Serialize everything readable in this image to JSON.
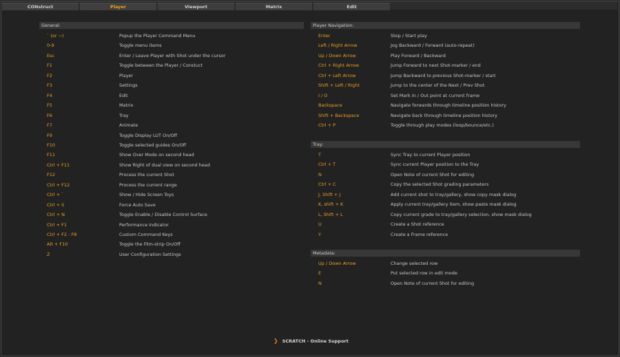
{
  "tabs": [
    {
      "label": "CONstruct",
      "active": false
    },
    {
      "label": "Player",
      "active": true
    },
    {
      "label": "Viewport",
      "active": false
    },
    {
      "label": "Matrix",
      "active": false
    },
    {
      "label": "Edit",
      "active": false
    }
  ],
  "colors": {
    "accent": "#f0a020",
    "text": "#c9c9c9",
    "background": "#222222",
    "section_bg": "#383838"
  },
  "sections": {
    "general": {
      "title": "General:",
      "rows": [
        {
          "key": "` (or ~)",
          "desc": "Popup the Player Command Menu"
        },
        {
          "key": "0-9",
          "desc": "Toggle menu items"
        },
        {
          "key": "Esc",
          "desc": "Enter / Leave Player with Shot under the cursor"
        },
        {
          "key": "F1",
          "desc": "Toggle between the Player / Constuct"
        },
        {
          "key": "F2",
          "desc": "Player"
        },
        {
          "key": "F3",
          "desc": "Settings"
        },
        {
          "key": "F4",
          "desc": "Edit"
        },
        {
          "key": "F5",
          "desc": "Matrix"
        },
        {
          "key": "F6",
          "desc": "Tray"
        },
        {
          "key": "F7",
          "desc": "Animate"
        },
        {
          "key": "F9",
          "desc": "Toggle Display LUT On/Off"
        },
        {
          "key": "F10",
          "desc": "Toggle selected guides On/Off"
        },
        {
          "key": "F11",
          "desc": "Show Over Mode on second head"
        },
        {
          "key": "Ctrl + F11",
          "desc": "Show Right of dual view on second head"
        },
        {
          "key": "F12",
          "desc": "Process the current Shot"
        },
        {
          "key": "Ctrl + F12",
          "desc": "Process the current range"
        },
        {
          "key": "Ctrl + `",
          "desc": "Show / Hide Screen Toys"
        },
        {
          "key": "Ctrl + S",
          "desc": "Force Auto Save"
        },
        {
          "key": "Ctrl + N",
          "desc": "Toggle Enable / Disable Control Surface"
        },
        {
          "key": "Ctrl + F1",
          "desc": "Performance indicator"
        },
        {
          "key": "Ctrl + F2 - F8",
          "desc": "Custom Command Keys"
        },
        {
          "key": "Alt + F10",
          "desc": "Toggle the Film-strip On/Off"
        },
        {
          "key": "Z",
          "desc": "User Configuration Settings"
        }
      ]
    },
    "player_navigation": {
      "title": "Player Navigation:",
      "rows": [
        {
          "key": "Enter",
          "desc": "Stop / Start play"
        },
        {
          "key": "Left / Right Arrow",
          "desc": "Jog Backward / Forward (auto-repeat)"
        },
        {
          "key": "Up / Down Arrow",
          "desc": "Play Forward / Backward"
        },
        {
          "key": "Ctrl + Right Arrow",
          "desc": "Jump Forward to next Shot-marker / end"
        },
        {
          "key": "Ctrl + Left Arrow",
          "desc": "Jump Backward to previous Shot-marker / start"
        },
        {
          "key": "Shift + Left / Right",
          "desc": "Jump to the center of the Next / Prev Shot"
        },
        {
          "key": "I / O",
          "desc": "Set Mark In / Out point at current frame"
        },
        {
          "key": "Backspace",
          "desc": "Navigate forwards through timeline position history"
        },
        {
          "key": "Shift + Backspace",
          "desc": "Navigate back through timeline position history"
        },
        {
          "key": "Ctrl + P",
          "desc": "Toggle through play modes (loop/bounce/etc.)"
        }
      ]
    },
    "tray": {
      "title": "Tray:",
      "rows": [
        {
          "key": "T",
          "desc": "Sync Tray to current Player position"
        },
        {
          "key": "Ctrl + T",
          "desc": "Sync current Player position to the Tray"
        },
        {
          "key": "N",
          "desc": "Open Note of current Shot for editing"
        },
        {
          "key": "Ctrl + C",
          "desc": "Copy the selected Shot grading parameters"
        },
        {
          "key": "J, Shift + J",
          "desc": "Add current shot to tray/gallery, show copy mask dialog"
        },
        {
          "key": "K, shift + K",
          "desc": "Apply current tray/gallery item, show paste mask dialog"
        },
        {
          "key": "L, Shift + L",
          "desc": "Copy current grade to tray/gallery selection, show mask dialog"
        },
        {
          "key": "U",
          "desc": "Create a Shot reference"
        },
        {
          "key": "Y",
          "desc": "Create a Frame reference"
        }
      ]
    },
    "metadata": {
      "title": "Metadata:",
      "rows": [
        {
          "key": "Up / Down Arrow",
          "desc": "Change selected row"
        },
        {
          "key": "E",
          "desc": "Put selected row in edit mode"
        },
        {
          "key": "N",
          "desc": "Open Note of current Shot for editing"
        }
      ]
    }
  },
  "footer": {
    "label": "SCRATCH - Online Support",
    "icon": "chevron-right-icon"
  }
}
